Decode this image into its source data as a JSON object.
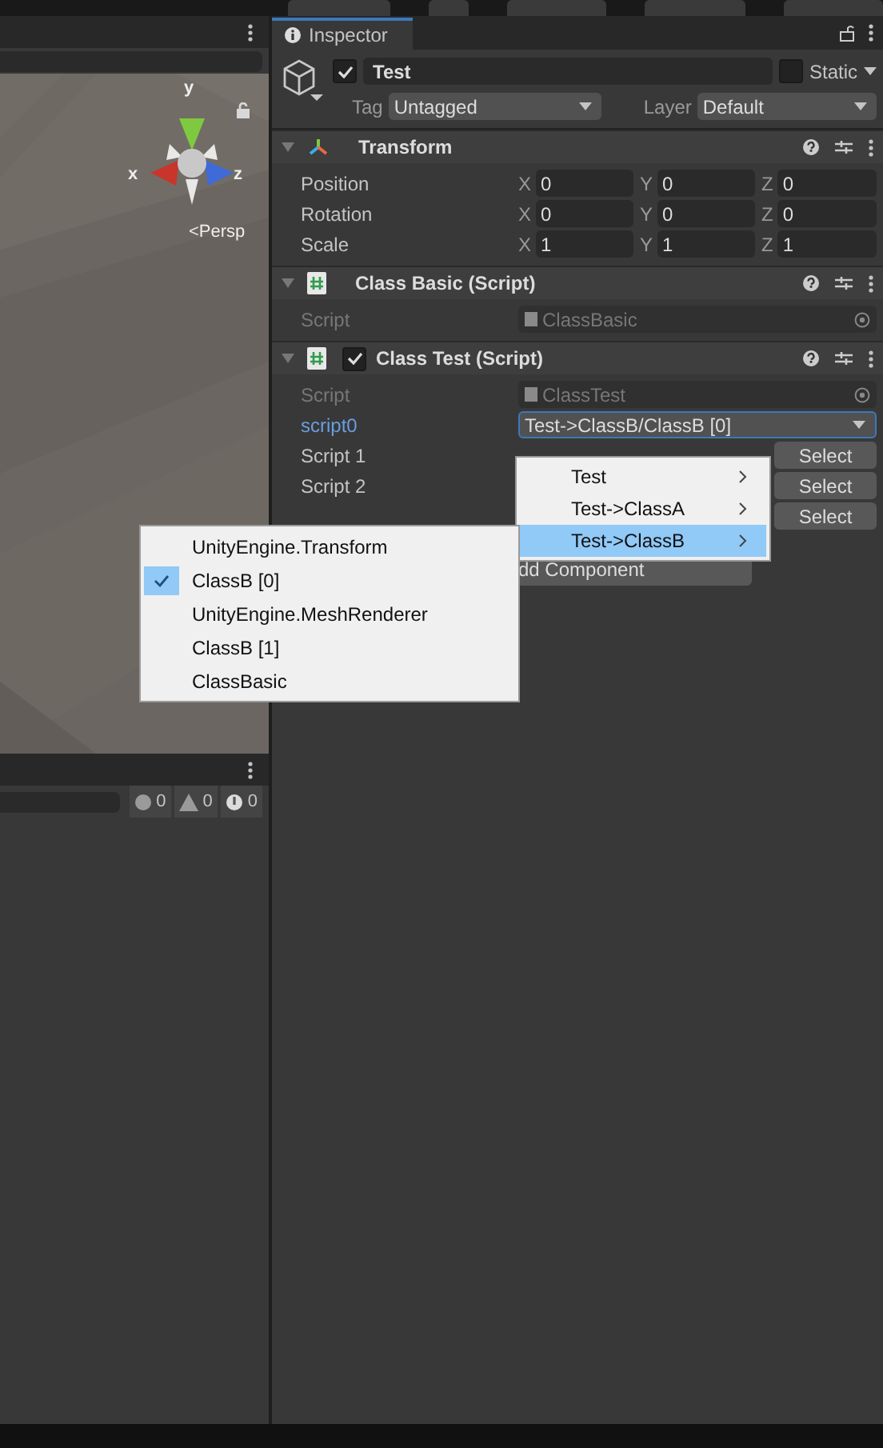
{
  "scene": {
    "view_label": "<Persp",
    "gizmo_axes": [
      "y",
      "x",
      "z"
    ]
  },
  "console": {
    "counts": [
      "0",
      "0",
      "0"
    ]
  },
  "inspector": {
    "tab": "Inspector",
    "object": {
      "active": true,
      "name": "Test",
      "static": false,
      "static_label": "Static",
      "tag_label": "Tag",
      "tag": "Untagged",
      "layer_label": "Layer",
      "layer": "Default"
    },
    "components": [
      {
        "kind": "transform",
        "title": "Transform",
        "rows": [
          {
            "label": "Position",
            "values": [
              {
                "axis": "X",
                "value": "0"
              },
              {
                "axis": "Y",
                "value": "0"
              },
              {
                "axis": "Z",
                "value": "0"
              }
            ]
          },
          {
            "label": "Rotation",
            "values": [
              {
                "axis": "X",
                "value": "0"
              },
              {
                "axis": "Y",
                "value": "0"
              },
              {
                "axis": "Z",
                "value": "0"
              }
            ]
          },
          {
            "label": "Scale",
            "values": [
              {
                "axis": "X",
                "value": "1"
              },
              {
                "axis": "Y",
                "value": "1"
              },
              {
                "axis": "Z",
                "value": "1"
              }
            ]
          }
        ]
      },
      {
        "kind": "script",
        "title": "Class Basic (Script)",
        "fields": [
          {
            "kind": "script",
            "label": "Script",
            "value": "ClassBasic"
          }
        ]
      },
      {
        "kind": "script",
        "title": "Class Test (Script)",
        "enabled": true,
        "fields": [
          {
            "kind": "script",
            "label": "Script",
            "value": "ClassTest"
          },
          {
            "kind": "dropdown",
            "label": "script0",
            "value": "Test->ClassB/ClassB [0]",
            "focused": true
          },
          {
            "kind": "select",
            "label": "Script 1",
            "button": "Select"
          },
          {
            "kind": "select",
            "label": "Script 2",
            "button": "Select"
          },
          {
            "kind": "select",
            "button": "Select"
          }
        ]
      }
    ],
    "add_component": "dd Component"
  },
  "submenu": [
    {
      "label": "Test",
      "selected": false
    },
    {
      "label": "Test->ClassA",
      "selected": false
    },
    {
      "label": "Test->ClassB",
      "selected": true
    }
  ],
  "popup_menu": [
    {
      "label": "UnityEngine.Transform",
      "checked": false
    },
    {
      "label": "ClassB [0]",
      "checked": true
    },
    {
      "label": "UnityEngine.MeshRenderer",
      "checked": false
    },
    {
      "label": "ClassB [1]",
      "checked": false
    },
    {
      "label": "ClassBasic",
      "checked": false
    }
  ]
}
